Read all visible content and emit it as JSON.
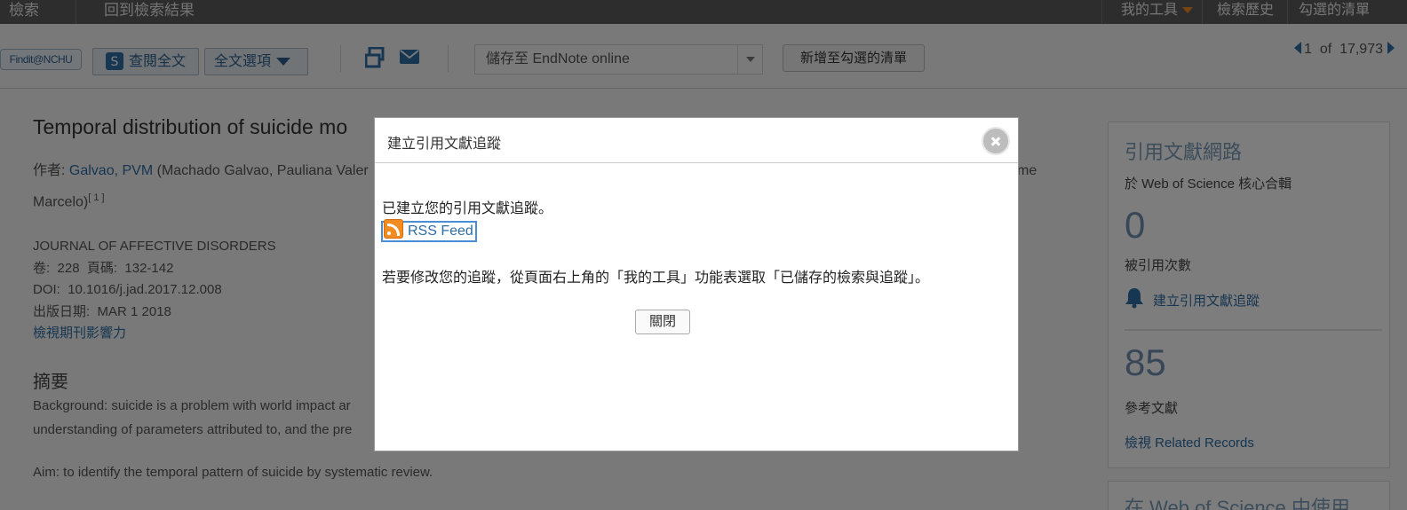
{
  "topbar": {
    "search": "檢索",
    "back_to_results": "回到檢索結果",
    "my_tools": "我的工具",
    "search_history": "檢索歷史",
    "marked_list": "勾選的清單"
  },
  "toolbar": {
    "findit": "Findit@NCHU",
    "full_text": "查閱全文",
    "full_text_options": "全文選項",
    "save_to": "儲存至 EndNote online",
    "add_to_marked": "新增至勾選的清單",
    "pager_current": "1",
    "pager_of": "of",
    "pager_total": "17,973"
  },
  "article": {
    "title": "Temporal distribution of suicide mo",
    "authors_prefix": "作者:",
    "author1": "Galvao, PVM",
    "author1_full": "(Machado Galvao, Pauliana Valer",
    "authors_trail": "me",
    "authors_line2": "Marcelo)",
    "author_sup": "[ 1 ]",
    "journal": "JOURNAL OF AFFECTIVE DISORDERS",
    "volume_label": "卷:",
    "volume": "228",
    "pages_label": "頁碼:",
    "pages": "132-142",
    "doi_label": "DOI:",
    "doi": "10.1016/j.jad.2017.12.008",
    "pubdate_label": "出版日期:",
    "pubdate": "MAR 1 2018",
    "impact_link": "檢視期刊影響力",
    "abstract_heading": "摘要",
    "abstract_line1": "Background: suicide is a problem with world impact ar",
    "abstract_line2": "understanding of parameters attributed to, and the pre",
    "abstract_aim": "Aim: to identify the temporal pattern of suicide by systematic review."
  },
  "citation_panel": {
    "heading": "引用文獻網路",
    "subheading": "於 Web of Science 核心合輯",
    "times_cited": "0",
    "times_cited_label": "被引用次數",
    "create_alert": "建立引用文獻追蹤",
    "references": "85",
    "references_label": "參考文獻",
    "view_related": "檢視 Related Records",
    "next_heading": "在 Web of Science 中使用"
  },
  "modal": {
    "title": "建立引用文獻追蹤",
    "message": "已建立您的引用文獻追蹤。",
    "rss_label": "RSS Feed",
    "instructions": "若要修改您的追蹤，從頁面右上角的「我的工具」功能表選取「已儲存的檢索與追蹤」。",
    "close_label": "關閉"
  },
  "colors": {
    "accent": "#2e6da4",
    "topbar": "#5a5a5a",
    "caret": "#f08a24",
    "rss": "#f28c21"
  }
}
